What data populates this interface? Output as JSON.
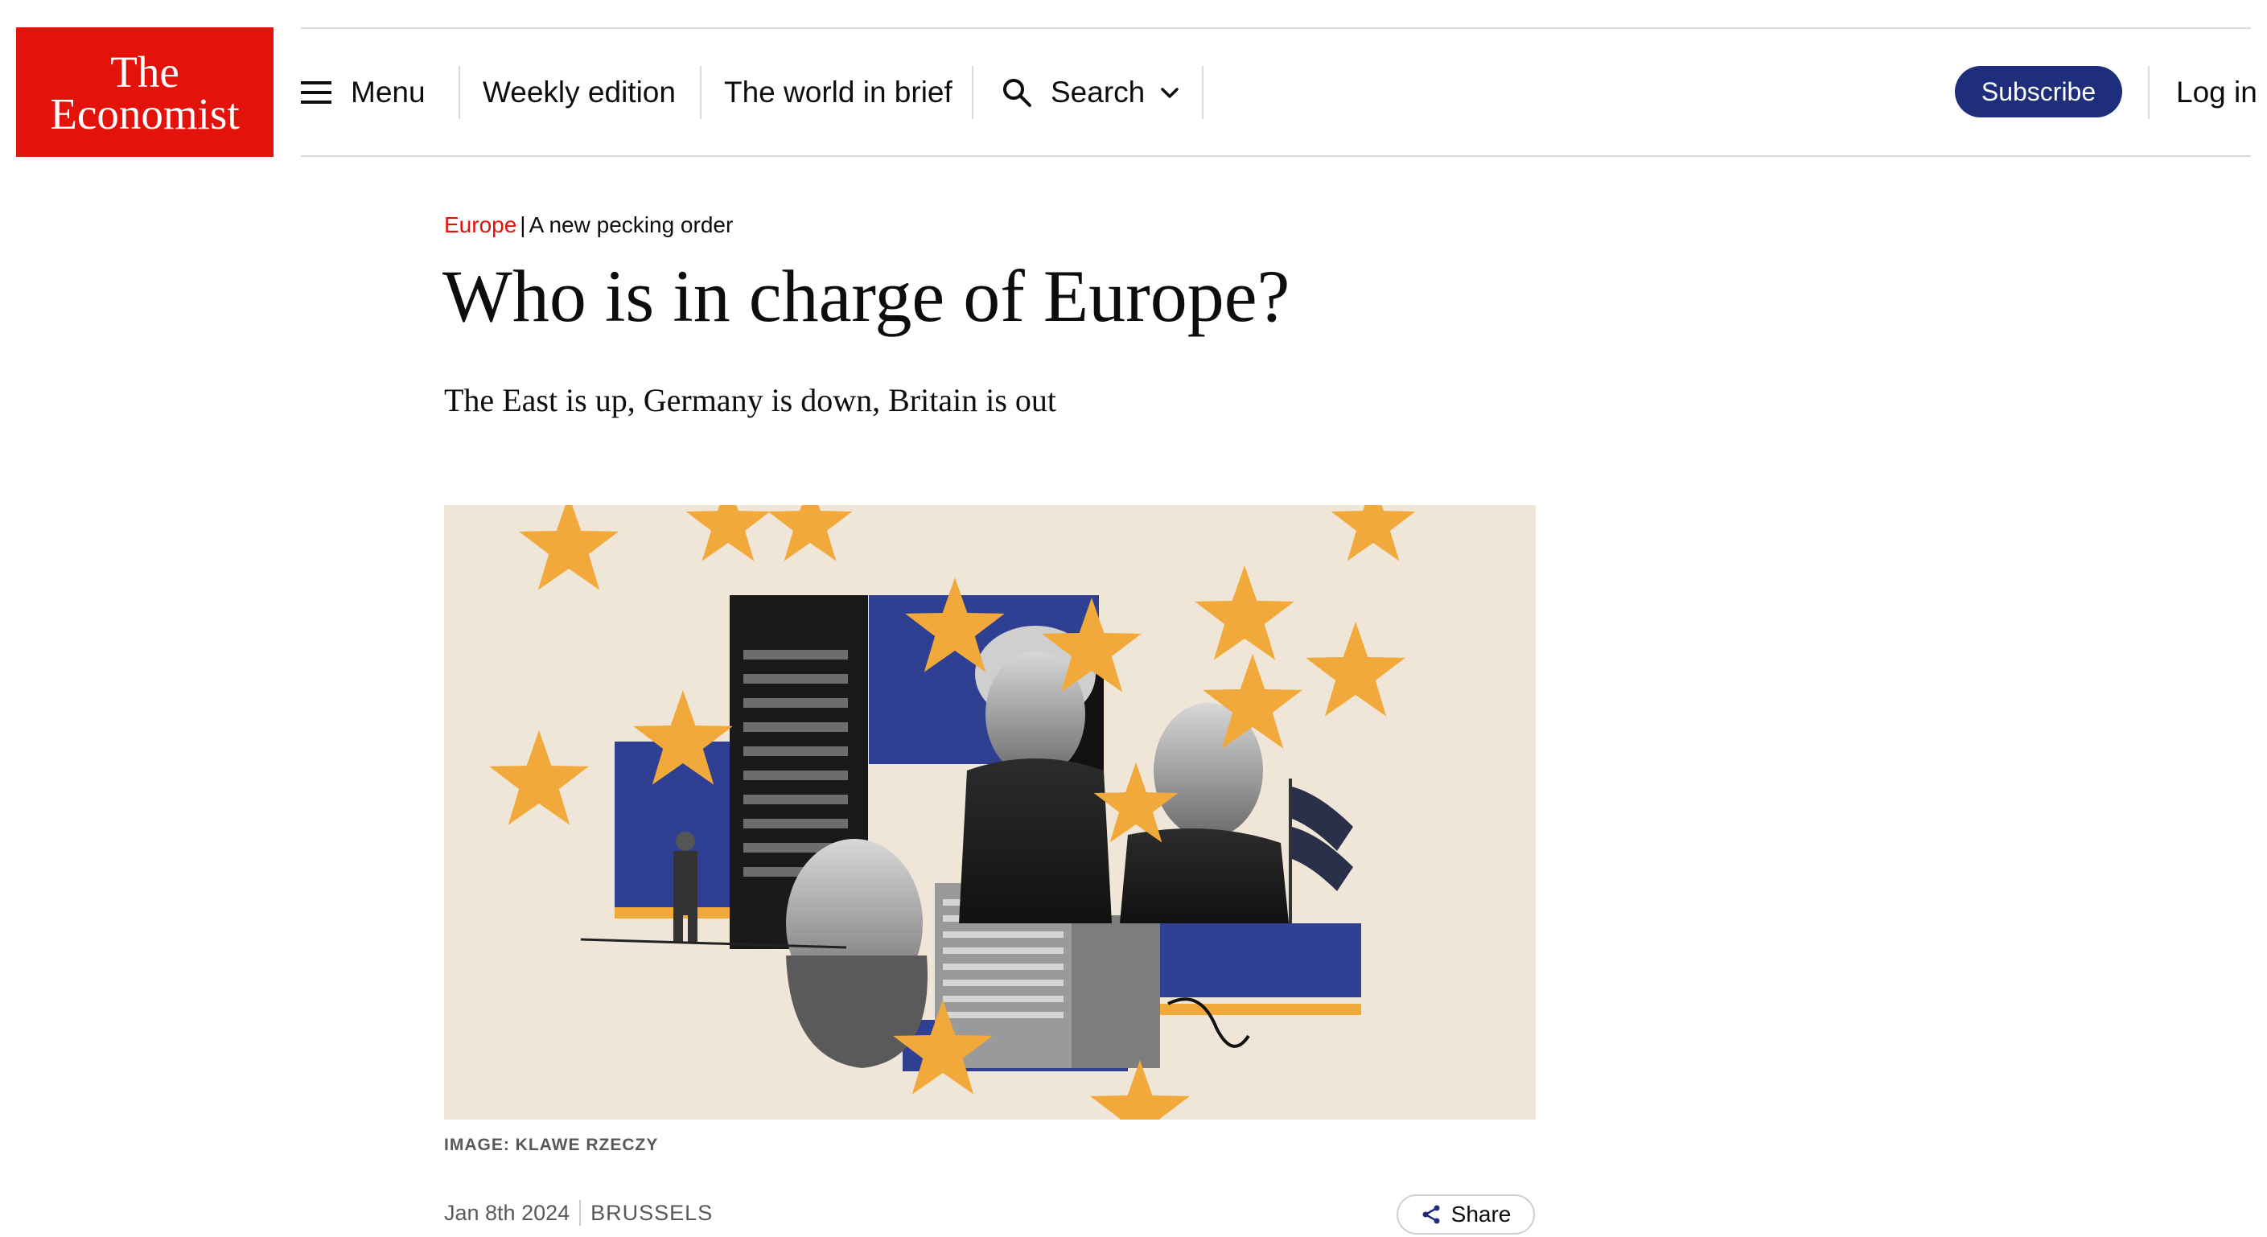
{
  "brand": {
    "logo_line1": "The",
    "logo_line2": "Economist",
    "color": "#e3120b"
  },
  "nav": {
    "menu_label": "Menu",
    "weekly_edition": "Weekly edition",
    "world_in_brief": "The world in brief",
    "search_label": "Search",
    "subscribe_label": "Subscribe",
    "login_label": "Log in",
    "subscribe_color": "#1f2e7a"
  },
  "article": {
    "section": "Europe",
    "rubric": "A new pecking order",
    "headline": "Who is in charge of Europe?",
    "subheadline": "The East is up, Germany is down, Britain is out",
    "image_caption": "IMAGE: KLAWE RZECZY",
    "date": "Jan 8th 2024",
    "dateline": "BRUSSELS",
    "share_label": "Share"
  },
  "icons": {
    "menu": "hamburger-icon",
    "search": "search-icon",
    "dropdown": "chevron-down-icon",
    "share": "share-icon"
  }
}
